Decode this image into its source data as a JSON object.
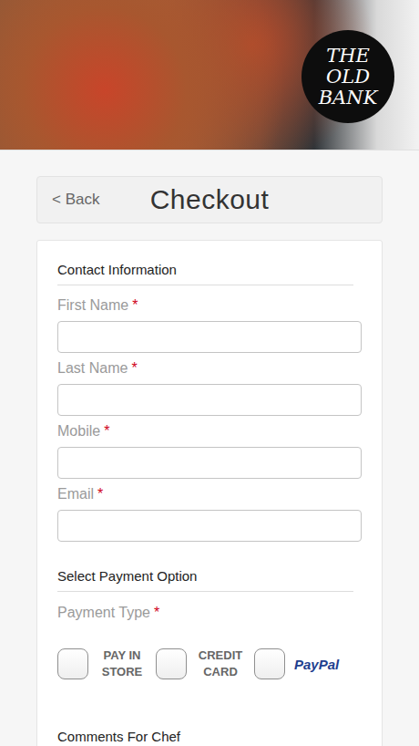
{
  "logo": {
    "lines": [
      "THE",
      "OLD",
      "BANK"
    ]
  },
  "header": {
    "back": "< Back",
    "title": "Checkout"
  },
  "required_mark": "*",
  "contact": {
    "title": "Contact Information",
    "fields": [
      {
        "label": "First Name",
        "required": true,
        "value": ""
      },
      {
        "label": "Last Name",
        "required": true,
        "value": ""
      },
      {
        "label": "Mobile",
        "required": true,
        "value": ""
      },
      {
        "label": "Email",
        "required": true,
        "value": ""
      }
    ]
  },
  "payment": {
    "title": "Select Payment Option",
    "label": "Payment Type",
    "required": true,
    "options": [
      {
        "label": "PAY IN STORE",
        "kind": "text",
        "checked": false
      },
      {
        "label": "CREDIT CARD",
        "kind": "text",
        "checked": false
      },
      {
        "label": "PayPal",
        "kind": "logo",
        "checked": false
      }
    ]
  },
  "comments": {
    "title": "Comments For Chef"
  }
}
